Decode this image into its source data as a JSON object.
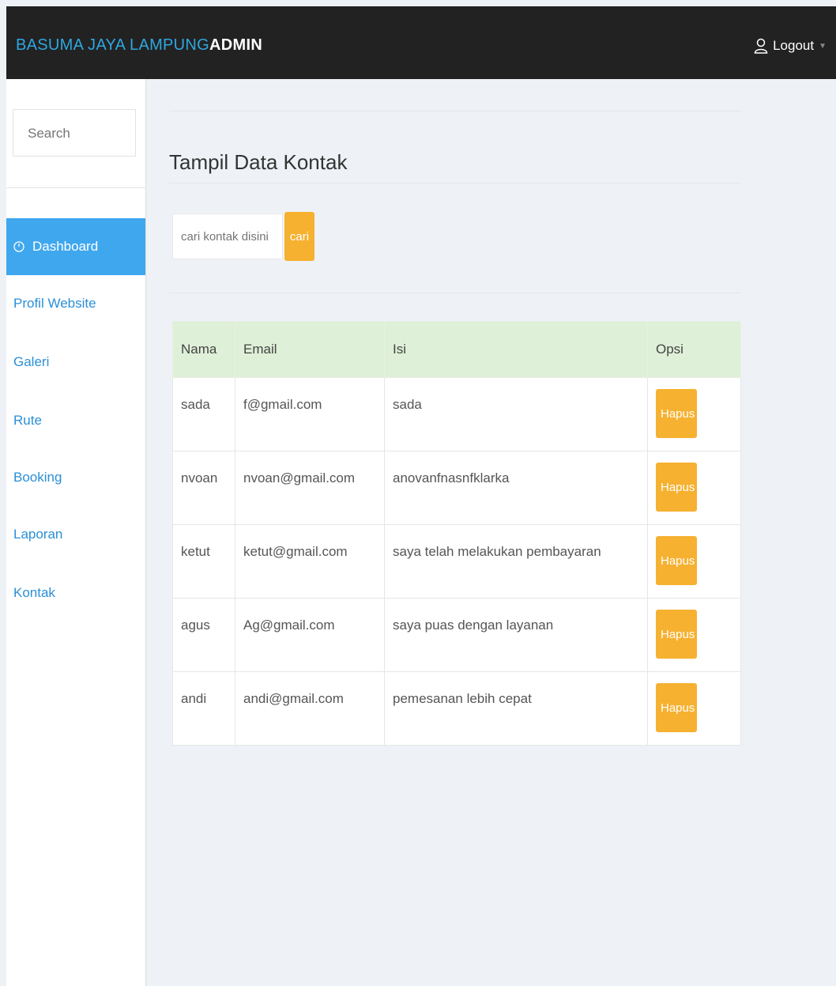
{
  "header": {
    "brand_accent": "BASUMA JAYA LAMPUNG",
    "brand_rest": "ADMIN",
    "logout_label": "Logout",
    "logout_icon": "user-icon"
  },
  "sidebar": {
    "search_placeholder": "Search",
    "items": [
      {
        "label": "Dashboard",
        "icon": "dashboard-icon",
        "active": true
      },
      {
        "label": "Profil Website"
      },
      {
        "label": "Galeri"
      },
      {
        "label": "Rute"
      },
      {
        "label": "Booking"
      },
      {
        "label": "Laporan"
      },
      {
        "label": "Kontak"
      }
    ]
  },
  "main": {
    "title": "Tampil Data Kontak",
    "search": {
      "placeholder": "cari kontak disini",
      "button_label": "cari"
    },
    "table": {
      "headers": [
        "Nama",
        "Email",
        "Isi",
        "Opsi"
      ],
      "rows": [
        {
          "nama": "sada",
          "email": "f@gmail.com",
          "isi": "sada",
          "action": "Hapus"
        },
        {
          "nama": "nvoan",
          "email": "nvoan@gmail.com",
          "isi": "anovanfnasnfklarka",
          "action": "Hapus"
        },
        {
          "nama": "ketut",
          "email": "ketut@gmail.com",
          "isi": "saya telah melakukan pembayaran",
          "action": "Hapus"
        },
        {
          "nama": "agus",
          "email": "Ag@gmail.com",
          "isi": "saya puas dengan layanan",
          "action": "Hapus"
        },
        {
          "nama": "andi",
          "email": "andi@gmail.com",
          "isi": "pemesanan lebih cepat",
          "action": "Hapus"
        }
      ]
    }
  },
  "colors": {
    "topbar": "#222222",
    "brand_accent": "#2ea7e0",
    "active_nav": "#3fa7ee",
    "nav_link": "#2a8fd6",
    "button": "#f6b130",
    "table_header": "#dff0d8"
  }
}
